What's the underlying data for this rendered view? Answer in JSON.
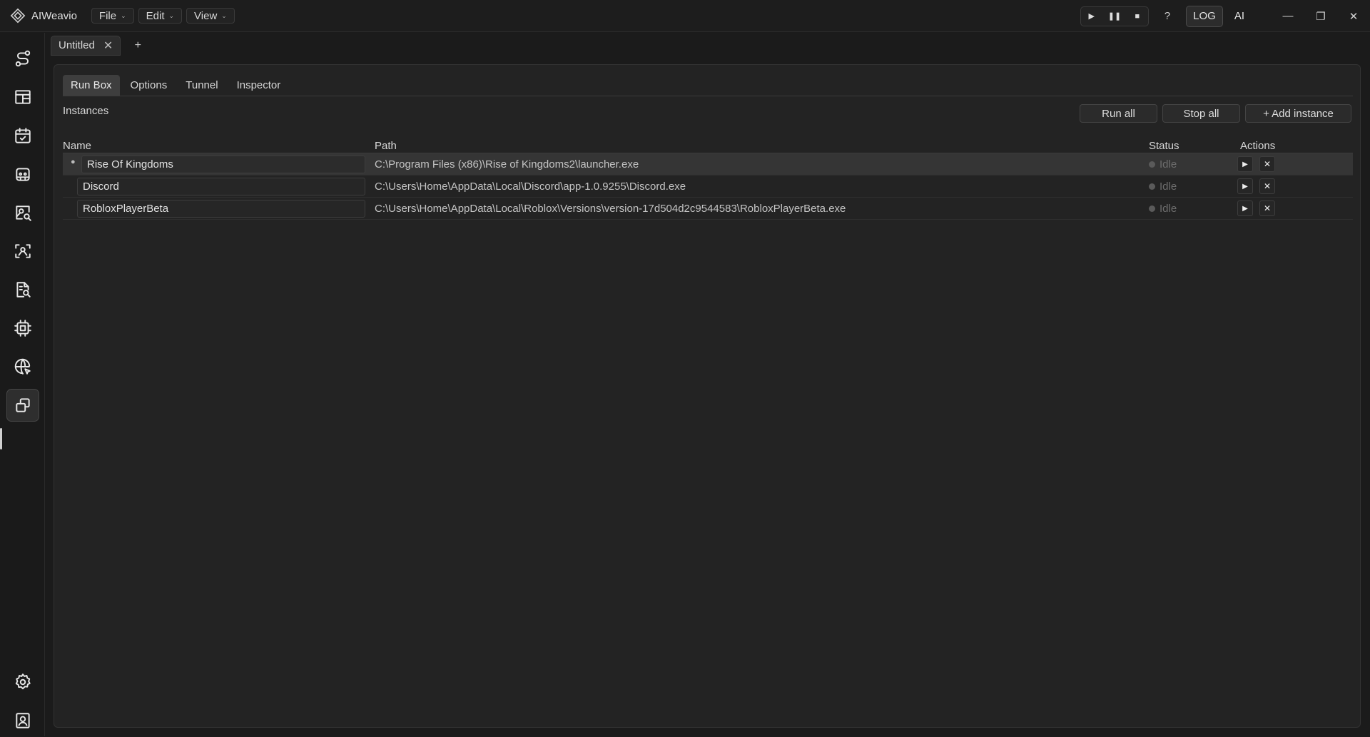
{
  "app": {
    "name": "AIWeavio"
  },
  "menu": {
    "file": "File",
    "edit": "Edit",
    "view": "View"
  },
  "titlebar": {
    "help": "?",
    "log": "LOG",
    "ai": "AI"
  },
  "doc_tabs": [
    {
      "label": "Untitled"
    }
  ],
  "new_tab_label": "+",
  "tabs": {
    "run_box": "Run Box",
    "options": "Options",
    "tunnel": "Tunnel",
    "inspector": "Inspector",
    "active": "Run Box"
  },
  "section": {
    "title": "Instances"
  },
  "buttons": {
    "run_all": "Run all",
    "stop_all": "Stop all",
    "add_instance": "+ Add instance"
  },
  "table": {
    "headers": {
      "name": "Name",
      "path": "Path",
      "status": "Status",
      "actions": "Actions"
    },
    "rows": [
      {
        "name": "Rise Of Kingdoms",
        "path": "C:\\Program Files (x86)\\Rise of Kingdoms2\\launcher.exe",
        "status": "Idle",
        "selected": true
      },
      {
        "name": "Discord",
        "path": "C:\\Users\\Home\\AppData\\Local\\Discord\\app-1.0.9255\\Discord.exe",
        "status": "Idle",
        "selected": false
      },
      {
        "name": "RobloxPlayerBeta",
        "path": "C:\\Users\\Home\\AppData\\Local\\Roblox\\Versions\\version-17d504d2c9544583\\RobloxPlayerBeta.exe",
        "status": "Idle",
        "selected": false
      }
    ]
  },
  "sidebar": {
    "items": [
      {
        "icon": "route-icon"
      },
      {
        "icon": "layout-icon"
      },
      {
        "icon": "calendar-check-icon"
      },
      {
        "icon": "bot-icon"
      },
      {
        "icon": "image-search-icon"
      },
      {
        "icon": "scan-face-icon"
      },
      {
        "icon": "file-search-icon"
      },
      {
        "icon": "cpu-icon"
      },
      {
        "icon": "globe-cursor-icon"
      },
      {
        "icon": "windows-icon"
      }
    ],
    "active": "windows-icon",
    "bottom": [
      {
        "icon": "settings-icon"
      },
      {
        "icon": "contact-icon"
      }
    ]
  },
  "colors": {
    "background": "#1b1b1b",
    "panel": "#232323",
    "accent": "#3e3e3e",
    "status_idle": "#6d6d6d"
  }
}
